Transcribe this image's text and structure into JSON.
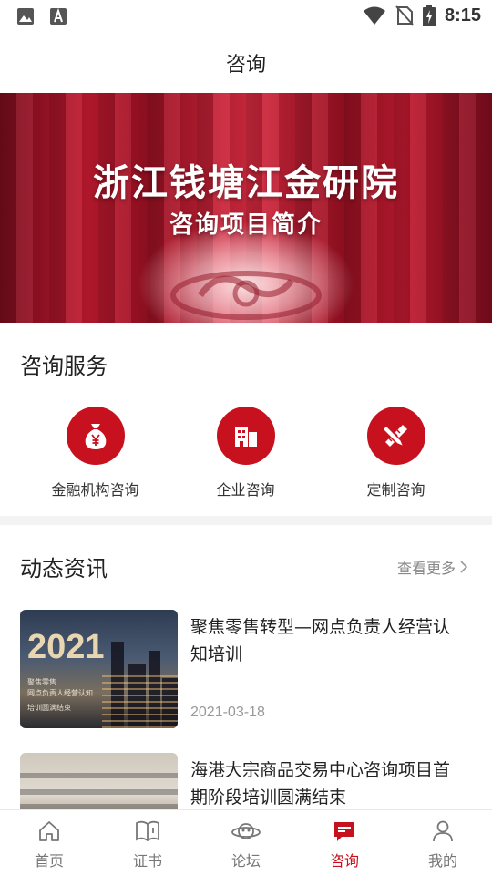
{
  "status_bar": {
    "time": "8:15"
  },
  "header": {
    "title": "咨询"
  },
  "banner": {
    "title": "浙江钱塘江金研院",
    "subtitle": "咨询项目简介"
  },
  "services": {
    "section_title": "咨询服务",
    "items": [
      {
        "label": "金融机构咨询",
        "icon": "money-bag-icon"
      },
      {
        "label": "企业咨询",
        "icon": "building-icon"
      },
      {
        "label": "定制咨询",
        "icon": "pencil-ruler-icon"
      }
    ]
  },
  "news": {
    "section_title": "动态资讯",
    "more_label": "查看更多",
    "items": [
      {
        "headline": "聚焦零售转型—网点负责人经营认知培训",
        "date": "2021-03-18",
        "thumb_text": {
          "year": "2021",
          "line1": "聚焦零售",
          "line2": "网点负责人经营认知",
          "line3": "培训圆满结束"
        }
      },
      {
        "headline": "海港大宗商品交易中心咨询项目首期阶段培训圆满结束",
        "date": ""
      }
    ]
  },
  "tab_bar": {
    "items": [
      {
        "label": "首页",
        "icon": "home-icon"
      },
      {
        "label": "证书",
        "icon": "book-icon"
      },
      {
        "label": "论坛",
        "icon": "planet-icon"
      },
      {
        "label": "咨询",
        "icon": "chat-icon",
        "active": true
      },
      {
        "label": "我的",
        "icon": "user-icon"
      }
    ]
  },
  "colors": {
    "accent": "#c8111e",
    "inactive": "#777777",
    "muted": "#999999"
  }
}
